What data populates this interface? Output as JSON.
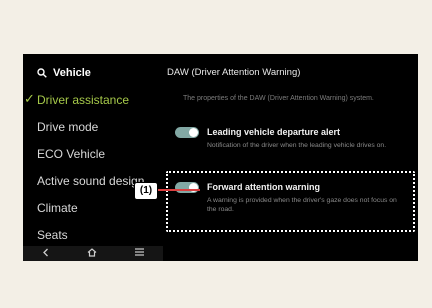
{
  "sidebar": {
    "search_label": "Vehicle",
    "items": [
      {
        "label": "Driver assistance",
        "active": true
      },
      {
        "label": "Drive mode",
        "active": false
      },
      {
        "label": "ECO Vehicle",
        "active": false
      },
      {
        "label": "Active sound design",
        "active": false
      },
      {
        "label": "Climate",
        "active": false
      },
      {
        "label": "Seats",
        "active": false
      }
    ]
  },
  "bottom_bar": {
    "back_icon": "chevron-left-icon",
    "home_icon": "home-icon",
    "menu_icon": "menu-icon"
  },
  "main": {
    "title": "DAW (Driver Attention Warning)",
    "description": "The properties of the DAW (Driver Attention Warning) system.",
    "options": [
      {
        "title": "Leading vehicle departure alert",
        "subtitle": "Notification of the driver when the leading vehicle drives on.",
        "enabled": true
      },
      {
        "title": "Forward attention warning",
        "subtitle": "A warning is provided when the driver's gaze does not focus on the road.",
        "enabled": true
      }
    ]
  },
  "callout": {
    "label": "(1)"
  },
  "colors": {
    "accent": "#a6c94a",
    "toggle": "#82a8a4",
    "highlight_line": "#d94040"
  }
}
